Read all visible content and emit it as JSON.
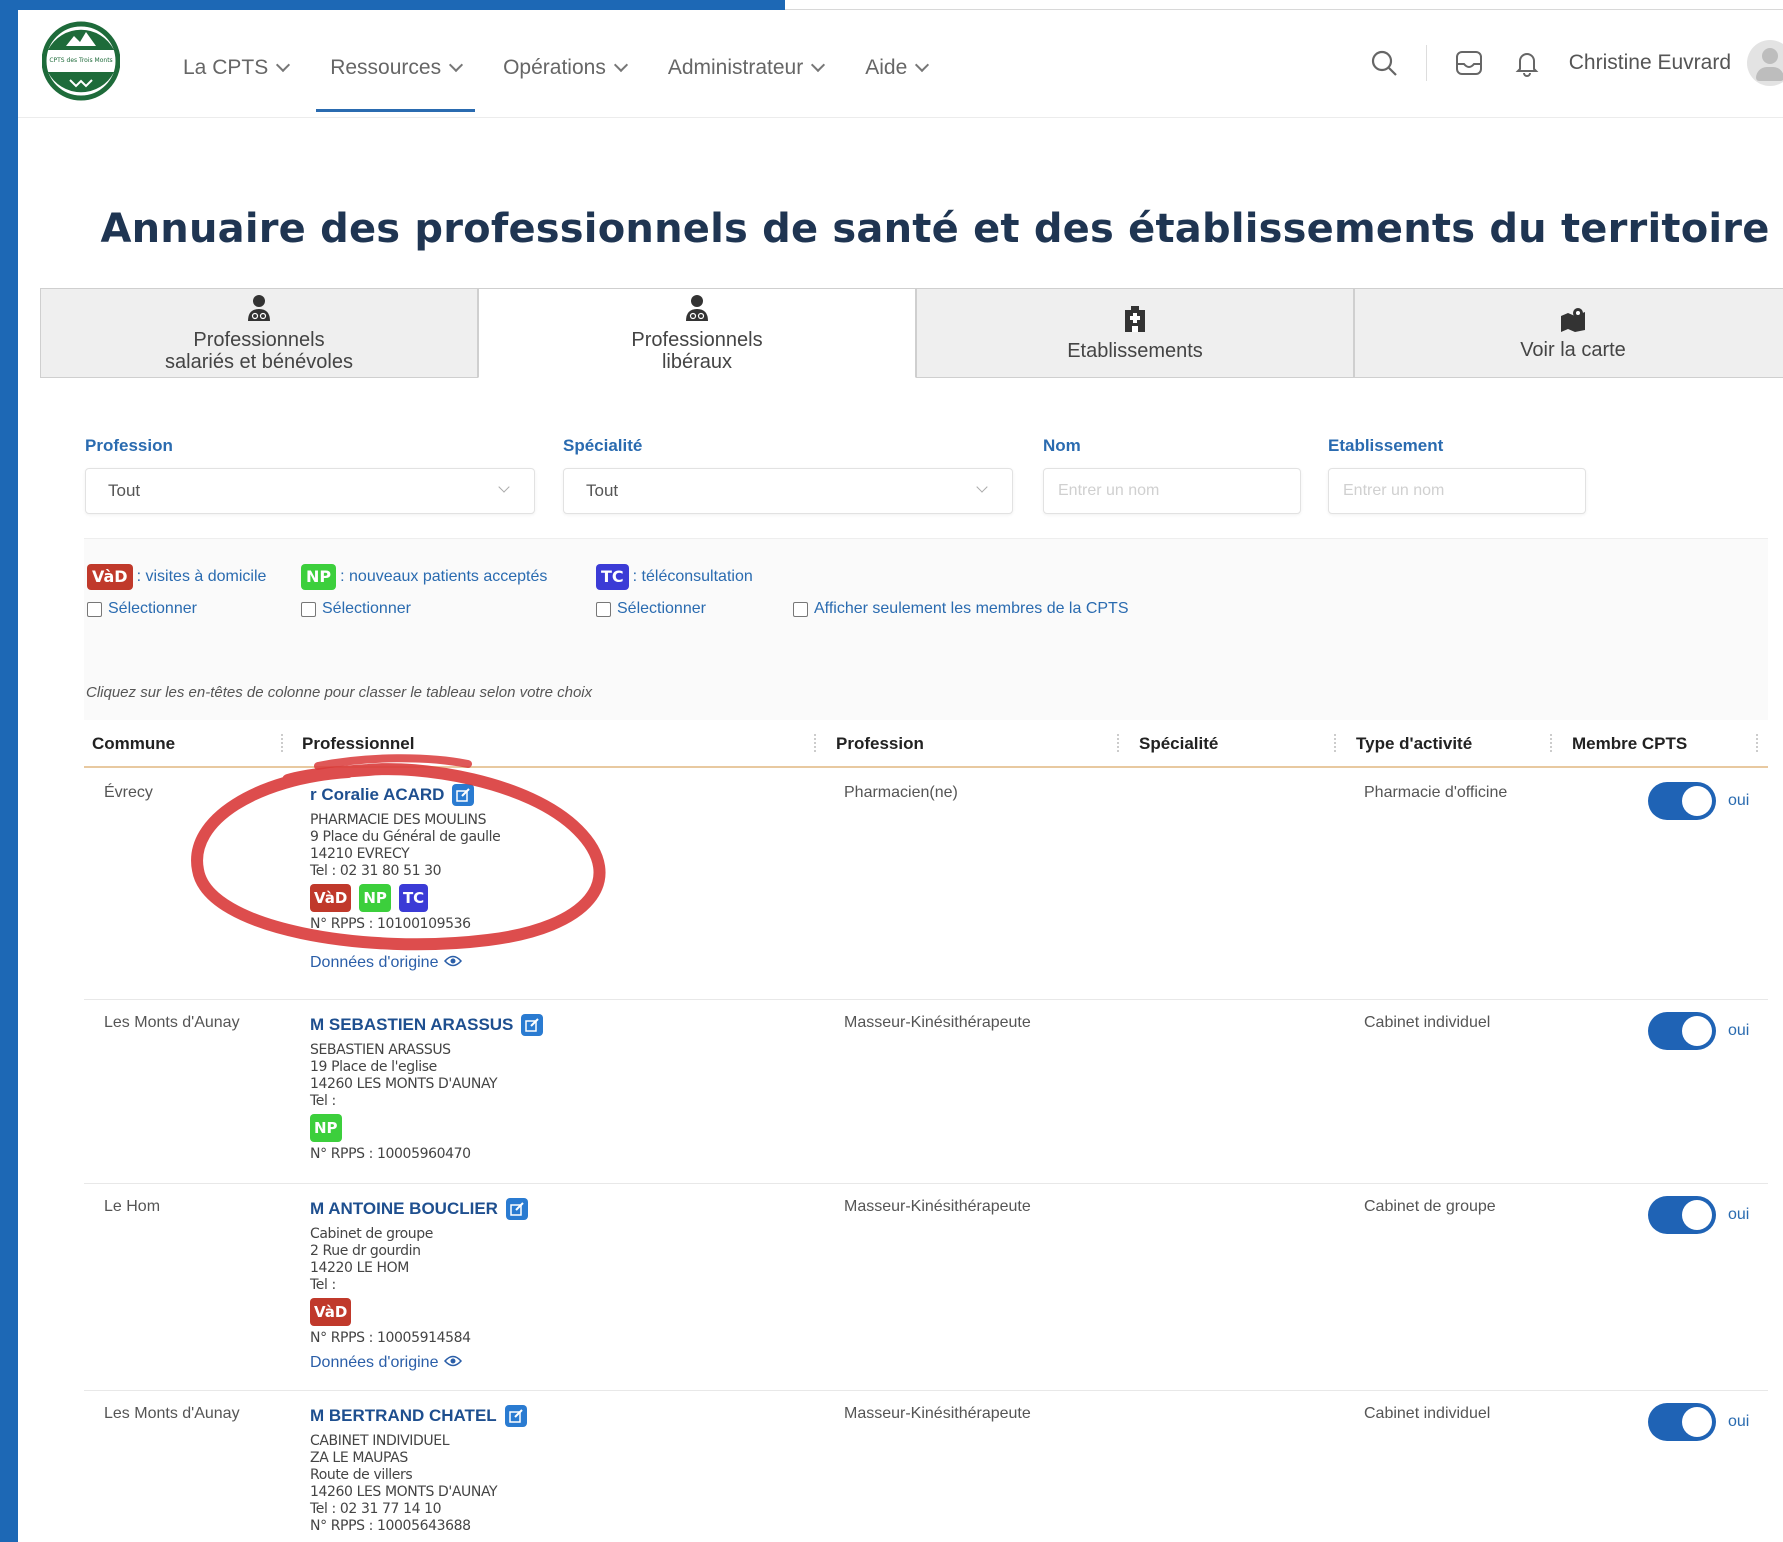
{
  "header": {
    "logo_text": "CPTS des Trois Monts",
    "nav": [
      {
        "label": "La CPTS"
      },
      {
        "label": "Ressources"
      },
      {
        "label": "Opérations"
      },
      {
        "label": "Administrateur"
      },
      {
        "label": "Aide"
      }
    ],
    "active_nav": "Ressources",
    "user_name": "Christine Euvrard"
  },
  "page_title": "Annuaire des professionnels de santé et des établissements du territoire",
  "tabs": [
    {
      "line1": "Professionnels",
      "line2": "salariés et bénévoles",
      "icon": "doctor-icon"
    },
    {
      "line1": "Professionnels",
      "line2": "libéraux",
      "icon": "doctor-icon"
    },
    {
      "line1": "Etablissements",
      "line2": "",
      "icon": "hospital-icon"
    },
    {
      "line1": "Voir la carte",
      "line2": "",
      "icon": "map-icon"
    }
  ],
  "active_tab": 1,
  "filters": {
    "profession": {
      "label": "Profession",
      "value": "Tout"
    },
    "specialite": {
      "label": "Spécialité",
      "value": "Tout"
    },
    "nom": {
      "label": "Nom",
      "placeholder": "Entrer un nom"
    },
    "etablissement": {
      "label": "Etablissement",
      "placeholder": "Entrer un nom"
    }
  },
  "legend": {
    "vad": {
      "badge": "VàD",
      "text": ": visites à domicile",
      "select": "Sélectionner",
      "color": "#c0392b"
    },
    "np": {
      "badge": "NP",
      "text": ": nouveaux patients acceptés",
      "select": "Sélectionner",
      "color": "#3ccf3c"
    },
    "tc": {
      "badge": "TC",
      "text": ": téléconsultation",
      "select": "Sélectionner",
      "color": "#3b3bd6"
    },
    "members_only": "Afficher seulement les membres de la CPTS"
  },
  "hint": "Cliquez sur les en-têtes de colonne pour classer le tableau selon votre choix",
  "table": {
    "columns": [
      "Commune",
      "Professionnel",
      "Profession",
      "Spécialité",
      "Type d'activité",
      "Membre CPTS"
    ],
    "rows": [
      {
        "commune": "Évrecy",
        "name": "r Coralie ACARD",
        "lines": [
          "PHARMACIE DES MOULINS",
          "9 Place du Général de gaulle",
          "14210 EVRECY",
          "Tel : 02 31 80 51 30"
        ],
        "badges": [
          "VàD",
          "NP",
          "TC"
        ],
        "rpps": "N° RPPS : 10100109536",
        "origin": "Données d'origine",
        "profession": "Pharmacien(ne)",
        "specialite": "",
        "type": "Pharmacie d'officine",
        "member": "oui"
      },
      {
        "commune": "Les Monts d'Aunay",
        "name": "M SEBASTIEN ARASSUS",
        "lines": [
          "SEBASTIEN ARASSUS",
          "19 Place de l'eglise",
          "14260 LES MONTS D'AUNAY",
          "Tel :"
        ],
        "badges": [
          "NP"
        ],
        "rpps": "N° RPPS : 10005960470",
        "origin": "",
        "profession": "Masseur-Kinésithérapeute",
        "specialite": "",
        "type": "Cabinet individuel",
        "member": "oui"
      },
      {
        "commune": "Le Hom",
        "name": "M ANTOINE BOUCLIER",
        "lines": [
          "Cabinet de groupe",
          "2 Rue dr gourdin",
          "14220 LE HOM",
          "Tel :"
        ],
        "badges": [
          "VàD"
        ],
        "rpps": "N° RPPS : 10005914584",
        "origin": "Données d'origine",
        "profession": "Masseur-Kinésithérapeute",
        "specialite": "",
        "type": "Cabinet de groupe",
        "member": "oui"
      },
      {
        "commune": "Les Monts d'Aunay",
        "name": "M BERTRAND CHATEL",
        "lines": [
          "CABINET INDIVIDUEL",
          "ZA LE MAUPAS",
          "Route de villers",
          "14260 LES MONTS D'AUNAY",
          "Tel : 02 31 77 14 10"
        ],
        "badges": [],
        "rpps": "N° RPPS : 10005643688",
        "origin": "",
        "profession": "Masseur-Kinésithérapeute",
        "specialite": "",
        "type": "Cabinet individuel",
        "member": "oui"
      }
    ]
  },
  "annotation_color": "#d93a3a"
}
